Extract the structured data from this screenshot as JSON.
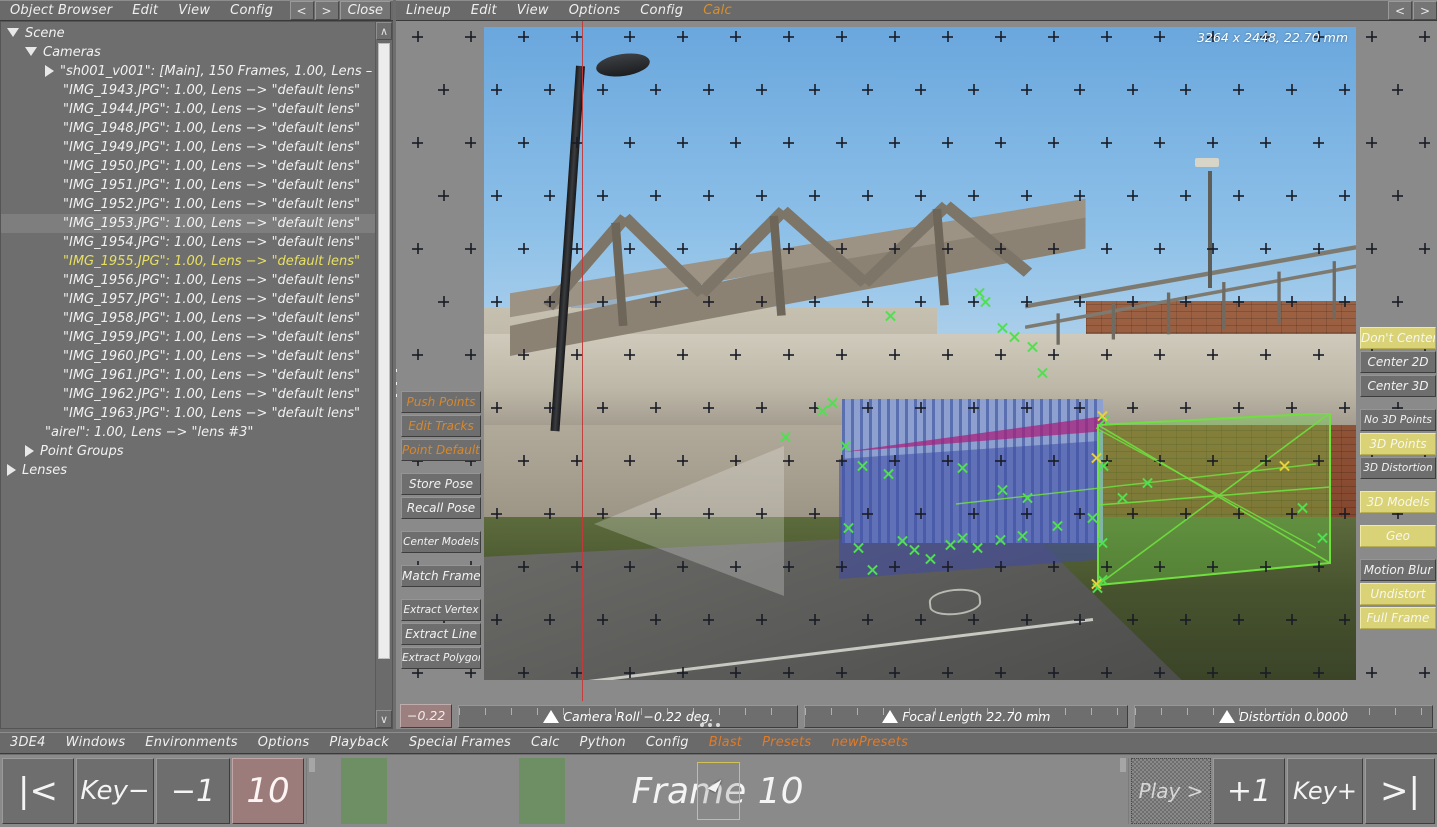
{
  "object_browser": {
    "menu": [
      "Object Browser",
      "Edit",
      "View",
      "Config"
    ],
    "nav_prev": "<",
    "nav_next": ">",
    "close_label": "Close",
    "scroll_up": "∧",
    "scroll_down": "∨",
    "tree": [
      {
        "indent": 0,
        "arrow": "down",
        "label": "Scene",
        "state": "normal"
      },
      {
        "indent": 1,
        "arrow": "down",
        "label": "Cameras",
        "state": "normal"
      },
      {
        "indent": 2,
        "arrow": "right",
        "label": "\"sh001_v001\":  [Main], 150 Frames, 1.00, Lens –",
        "state": "normal"
      },
      {
        "indent": 3,
        "arrow": "none",
        "label": "\"IMG_1943.JPG\":  1.00, Lens −> \"default lens\"",
        "state": "normal"
      },
      {
        "indent": 3,
        "arrow": "none",
        "label": "\"IMG_1944.JPG\":  1.00, Lens −> \"default lens\"",
        "state": "normal"
      },
      {
        "indent": 3,
        "arrow": "none",
        "label": "\"IMG_1948.JPG\":  1.00, Lens −> \"default lens\"",
        "state": "normal"
      },
      {
        "indent": 3,
        "arrow": "none",
        "label": "\"IMG_1949.JPG\":  1.00, Lens −> \"default lens\"",
        "state": "normal"
      },
      {
        "indent": 3,
        "arrow": "none",
        "label": "\"IMG_1950.JPG\":  1.00, Lens −> \"default lens\"",
        "state": "normal"
      },
      {
        "indent": 3,
        "arrow": "none",
        "label": "\"IMG_1951.JPG\":  1.00, Lens −> \"default lens\"",
        "state": "normal"
      },
      {
        "indent": 3,
        "arrow": "none",
        "label": "\"IMG_1952.JPG\":  1.00, Lens −> \"default lens\"",
        "state": "normal"
      },
      {
        "indent": 3,
        "arrow": "none",
        "label": "\"IMG_1953.JPG\":  1.00, Lens −> \"default lens\"",
        "state": "selected"
      },
      {
        "indent": 3,
        "arrow": "none",
        "label": "\"IMG_1954.JPG\":  1.00, Lens −> \"default lens\"",
        "state": "normal"
      },
      {
        "indent": 3,
        "arrow": "none",
        "label": "\"IMG_1955.JPG\":  1.00, Lens −> \"default lens\"",
        "state": "highlighted"
      },
      {
        "indent": 3,
        "arrow": "none",
        "label": "\"IMG_1956.JPG\":  1.00, Lens −> \"default lens\"",
        "state": "normal"
      },
      {
        "indent": 3,
        "arrow": "none",
        "label": "\"IMG_1957.JPG\":  1.00, Lens −> \"default lens\"",
        "state": "normal"
      },
      {
        "indent": 3,
        "arrow": "none",
        "label": "\"IMG_1958.JPG\":  1.00, Lens −> \"default lens\"",
        "state": "normal"
      },
      {
        "indent": 3,
        "arrow": "none",
        "label": "\"IMG_1959.JPG\":  1.00, Lens −> \"default lens\"",
        "state": "normal"
      },
      {
        "indent": 3,
        "arrow": "none",
        "label": "\"IMG_1960.JPG\":  1.00, Lens −> \"default lens\"",
        "state": "normal"
      },
      {
        "indent": 3,
        "arrow": "none",
        "label": "\"IMG_1961.JPG\":  1.00, Lens −> \"default lens\"",
        "state": "normal"
      },
      {
        "indent": 3,
        "arrow": "none",
        "label": "\"IMG_1962.JPG\":  1.00, Lens −> \"default lens\"",
        "state": "normal"
      },
      {
        "indent": 3,
        "arrow": "none",
        "label": "\"IMG_1963.JPG\":  1.00, Lens −> \"default lens\"",
        "state": "normal"
      },
      {
        "indent": 2,
        "arrow": "none",
        "label": "\"airel\":  1.00, Lens −> \"lens #3\"",
        "state": "normal"
      },
      {
        "indent": 1,
        "arrow": "right",
        "label": "Point Groups",
        "state": "normal"
      },
      {
        "indent": 0,
        "arrow": "right",
        "label": "Lenses",
        "state": "normal"
      }
    ]
  },
  "viewport": {
    "menu": [
      {
        "label": "Lineup",
        "accent": false
      },
      {
        "label": "Edit",
        "accent": false
      },
      {
        "label": "View",
        "accent": false
      },
      {
        "label": "Options",
        "accent": false
      },
      {
        "label": "Config",
        "accent": false
      },
      {
        "label": "Calc",
        "accent": true
      }
    ],
    "nav_prev": "<",
    "nav_next": ">",
    "plate_info": "3264 x 2448, 22.70 mm",
    "left_tools": [
      {
        "label": "Push Points",
        "style": "orange",
        "gap": false
      },
      {
        "label": "Edit Tracks",
        "style": "orange",
        "gap": false
      },
      {
        "label": "Point Defaults",
        "style": "orange",
        "gap": false
      },
      {
        "label": "Store Pose",
        "style": "normal",
        "gap": true
      },
      {
        "label": "Recall Pose",
        "style": "normal",
        "gap": false
      },
      {
        "label": "Center Models",
        "style": "small",
        "gap": true
      },
      {
        "label": "Match Frame",
        "style": "normal",
        "gap": true
      },
      {
        "label": "Extract Vertex",
        "style": "small",
        "gap": true
      },
      {
        "label": "Extract Line",
        "style": "normal",
        "gap": false
      },
      {
        "label": "Extract Polygon",
        "style": "small",
        "gap": false
      }
    ],
    "right_tools": [
      {
        "label": "Don't Center",
        "active": true,
        "gap": false,
        "small": false
      },
      {
        "label": "Center 2D",
        "active": false,
        "gap": false,
        "small": false
      },
      {
        "label": "Center 3D",
        "active": false,
        "gap": false,
        "small": false
      },
      {
        "label": "No 3D Points",
        "active": false,
        "gap": true,
        "small": true
      },
      {
        "label": "3D Points",
        "active": true,
        "gap": false,
        "small": false
      },
      {
        "label": "3D Distortion",
        "active": false,
        "gap": false,
        "small": true
      },
      {
        "label": "3D Models",
        "active": true,
        "gap": true,
        "small": false
      },
      {
        "label": "Geo",
        "active": true,
        "gap": true,
        "small": false
      },
      {
        "label": "Motion Blur",
        "active": false,
        "gap": true,
        "small": false
      },
      {
        "label": "Undistort",
        "active": true,
        "gap": false,
        "small": false
      },
      {
        "label": "Full Frame",
        "active": true,
        "gap": false,
        "small": false
      }
    ],
    "sliders": {
      "roll_value": "−0.22",
      "roll_label": "Camera Roll −0.22 deg.",
      "focal_label": "Focal Length 22.70 mm",
      "distortion_label": "Distortion 0.0000"
    }
  },
  "main_menu": {
    "items": [
      {
        "label": "3DE4",
        "accent": false
      },
      {
        "label": "Windows",
        "accent": false
      },
      {
        "label": "Environments",
        "accent": false
      },
      {
        "label": "Options",
        "accent": false
      },
      {
        "label": "Playback",
        "accent": false
      },
      {
        "label": "Special Frames",
        "accent": false
      },
      {
        "label": "Calc",
        "accent": false
      },
      {
        "label": "Python",
        "accent": false
      },
      {
        "label": "Config",
        "accent": false
      },
      {
        "label": "Blast",
        "accent": true
      },
      {
        "label": "Presets",
        "accent": true
      },
      {
        "label": "newPresets",
        "accent": true
      }
    ]
  },
  "playback": {
    "first_frame_label": "|<",
    "key_prev_label": "Key−",
    "step_back_label": "−1",
    "current_frame_number": "10",
    "frame_label": "Frame 10",
    "play_label": "Play >",
    "step_fwd_label": "+1",
    "key_next_label": "Key+",
    "last_frame_label": ">|"
  },
  "colors": {
    "panel_bg": "#6e6e6e",
    "canvas_bg": "#8a8a8a",
    "accent_orange": "#d8882c",
    "active_yellow": "#d9d277",
    "frame_red": "#9c7b7b",
    "keyframe_green": "#6d8f63",
    "track_green": "#4fe04f"
  }
}
